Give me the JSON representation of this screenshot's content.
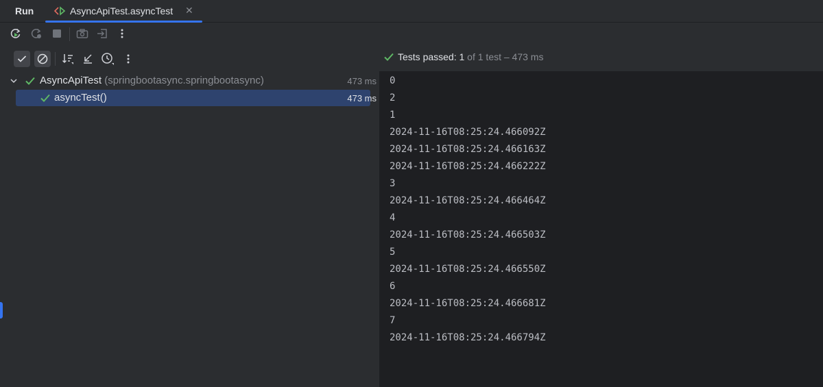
{
  "window": {
    "tool_window_title": "Run",
    "tab": {
      "title": "AsyncApiTest.asyncTest",
      "close_glyph": "✕",
      "icon": "run-config-icon"
    }
  },
  "toolbar": {
    "row1_icons": [
      "rerun-icon",
      "rerun-failed-icon",
      "stop-icon",
      "screenshot-icon",
      "exit-icon",
      "more-vertical-icon"
    ],
    "row2_icons": [
      "show-passed-icon",
      "show-ignored-icon",
      "sort-icon",
      "collapse-icon",
      "history-icon",
      "more-vertical-icon"
    ]
  },
  "status": {
    "prefix": "Tests passed: ",
    "count": "1",
    "suffix": " of 1 test – 473 ms",
    "color": "#5fb865"
  },
  "tree": {
    "suite": {
      "name": "AsyncApiTest",
      "package": "(springbootasync.springbootasync)",
      "time": "473 ms"
    },
    "test": {
      "name": "asyncTest()",
      "time": "473 ms"
    }
  },
  "console": {
    "lines": [
      "0",
      "2",
      "1",
      "2024-11-16T08:25:24.466092Z",
      "2024-11-16T08:25:24.466163Z",
      "2024-11-16T08:25:24.466222Z",
      "3",
      "2024-11-16T08:25:24.466464Z",
      "4",
      "2024-11-16T08:25:24.466503Z",
      "5",
      "2024-11-16T08:25:24.466550Z",
      "6",
      "2024-11-16T08:25:24.466681Z",
      "7",
      "2024-11-16T08:25:24.466794Z"
    ]
  }
}
